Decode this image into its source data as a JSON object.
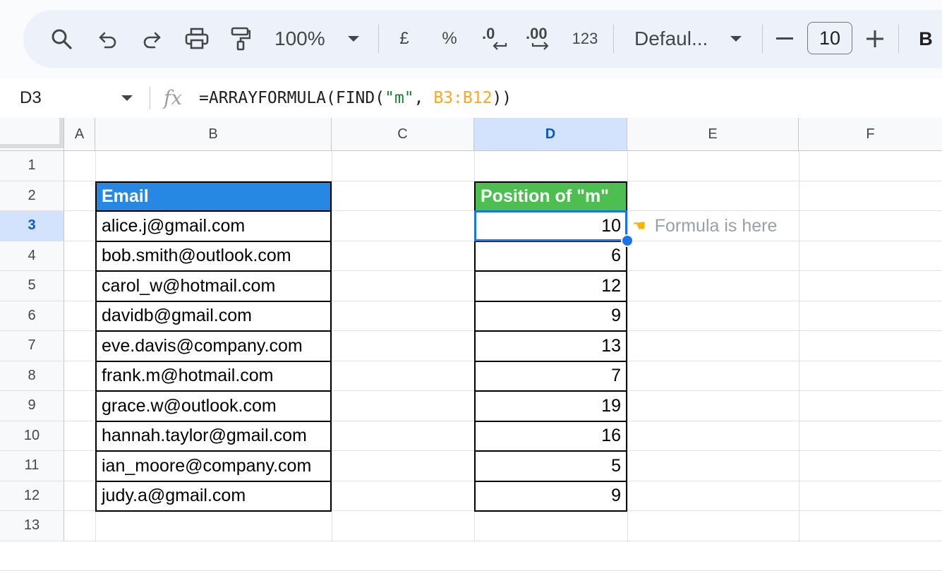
{
  "toolbar": {
    "zoom": "100%",
    "currency_symbol": "£",
    "percent_symbol": "%",
    "decrease_decimal_label": ".0",
    "increase_decimal_label": ".00",
    "more_formats_label": "123",
    "font_name": "Defaul...",
    "font_size": "10",
    "bold_label": "B"
  },
  "formula_bar": {
    "cell_ref": "D3",
    "fx_label": "fx",
    "formula": {
      "prefix": "=ARRAYFORMULA(FIND(",
      "string_arg": "\"m\"",
      "separator": ", ",
      "range_arg": "B3:B12",
      "suffix": "))"
    }
  },
  "grid": {
    "columns": [
      "A",
      "B",
      "C",
      "D",
      "E",
      "F"
    ],
    "selected_column": "D",
    "rows": [
      "1",
      "2",
      "3",
      "4",
      "5",
      "6",
      "7",
      "8",
      "9",
      "10",
      "11",
      "12",
      "13"
    ],
    "selected_row": "3",
    "email_header": "Email",
    "position_header": "Position of \"m\"",
    "emails": [
      "alice.j@gmail.com",
      "bob.smith@outlook.com",
      "carol_w@hotmail.com",
      "davidb@gmail.com",
      "eve.davis@company.com",
      "frank.m@hotmail.com",
      "grace.w@outlook.com",
      "hannah.taylor@gmail.com",
      "ian_moore@company.com",
      "judy.a@gmail.com"
    ],
    "positions": [
      "10",
      "6",
      "12",
      "9",
      "13",
      "7",
      "19",
      "16",
      "5",
      "9"
    ],
    "note_icon": "pointing-hand-left",
    "note_text": "Formula is here",
    "colors": {
      "email_header_bg": "#2688e3",
      "position_header_bg": "#4cbf50",
      "selection": "#1a73e8"
    }
  }
}
